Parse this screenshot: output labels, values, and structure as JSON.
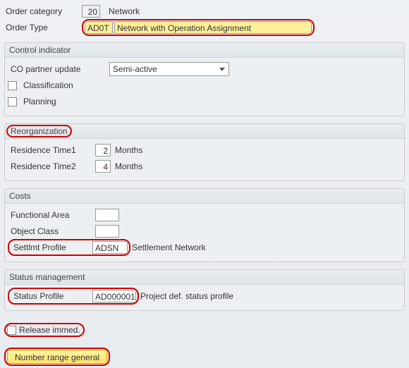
{
  "header": {
    "order_category_label": "Order category",
    "order_category_value": "20",
    "order_category_desc": "Network",
    "order_type_label": "Order Type",
    "order_type_value": "AD0T",
    "order_type_desc": "Network with Operation Assignment"
  },
  "control_indicator": {
    "title": "Control indicator",
    "co_partner_label": "CO partner update",
    "co_partner_value": "Semi-active",
    "classification_label": "Classification",
    "planning_label": "Planning"
  },
  "reorganization": {
    "title": "Reorganization",
    "res1_label": "Residence Time1",
    "res1_value": "2",
    "res1_unit": "Months",
    "res2_label": "Residence Time2",
    "res2_value": "4",
    "res2_unit": "Months"
  },
  "costs": {
    "title": "Costs",
    "functional_area_label": "Functional Area",
    "functional_area_value": "",
    "object_class_label": "Object Class",
    "object_class_value": "",
    "settlmt_profile_label": "Settlmt Profile",
    "settlmt_profile_value": "ADSN",
    "settlmt_profile_desc": "Settlement Network"
  },
  "status_mgmt": {
    "title": "Status management",
    "status_profile_label": "Status Profile",
    "status_profile_value": "AD000001",
    "status_profile_desc": "Project def. status profile"
  },
  "release_immed_label": "Release immed.",
  "number_range_btn": "Number range general"
}
